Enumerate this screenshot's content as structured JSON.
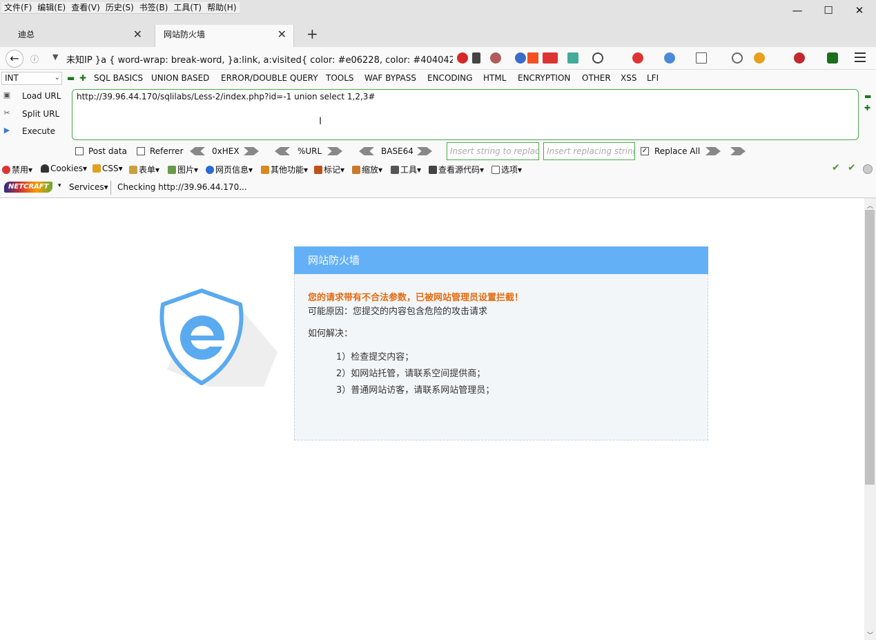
{
  "menubar": {
    "items": [
      "文件(F)",
      "编辑(E)",
      "查看(V)",
      "历史(S)",
      "书签(B)",
      "工具(T)",
      "帮助(H)"
    ]
  },
  "window_controls": {
    "minimize": "—",
    "maximize": "☐",
    "close": "✕"
  },
  "tabs": [
    {
      "label": "迪总"
    },
    {
      "label": "网站防火墙"
    }
  ],
  "tab_close": "✕",
  "new_tab": "+",
  "navbar": {
    "back": "←",
    "info": "ⓘ",
    "dropdown": "▼",
    "url_text": "未知IP   }a { word-wrap: break-word, }a:link, a:visited{ color: #e06228, color: #404042"
  },
  "hackbar": {
    "select_value": "INT",
    "menus": [
      "SQL BASICS",
      "UNION BASED",
      "ERROR/DOUBLE QUERY",
      "TOOLS",
      "WAF BYPASS",
      "ENCODING",
      "HTML",
      "ENCRYPTION",
      "OTHER",
      "XSS",
      "LFI"
    ],
    "load_url": "Load URL",
    "split_url": "Split URL",
    "execute": "Execute",
    "url_value": "http://39.96.44.170/sqlilabs/Less-2/index.php?id=-1 union select 1,2,3#",
    "post_data": "Post data",
    "referrer": "Referrer",
    "hex": "0xHEX",
    "url_enc": "%URL",
    "base64": "BASE64",
    "replace_placeholder": "Insert string to replace",
    "replacing_placeholder": "Insert replacing string",
    "replace_all": "Replace All"
  },
  "toolbar2": {
    "items": [
      "禁用",
      "Cookies",
      "CSS",
      "表单",
      "图片",
      "网页信息",
      "其他功能",
      "标记",
      "缩放",
      "工具",
      "查看源代码",
      "选项"
    ]
  },
  "toolbar3": {
    "netcraft": "NETCRAFT",
    "services": "Services",
    "status": "Checking http://39.96.44.170..."
  },
  "page": {
    "card_title": "网站防火墙",
    "warning": "您的请求带有不合法参数，已被网站管理员设置拦截！",
    "reason": "可能原因：您提交的内容包含危险的攻击请求",
    "howto": "如何解决：",
    "steps": [
      "1）检查提交内容；",
      "2）如网站托管，请联系空间提供商；",
      "3）普通网站访客，请联系网站管理员；"
    ]
  },
  "colors": {
    "card_header": "#63b0f7",
    "warning": "#e36b10",
    "hackbar_border": "#4aa84a",
    "logo": "#5aaaf0"
  }
}
